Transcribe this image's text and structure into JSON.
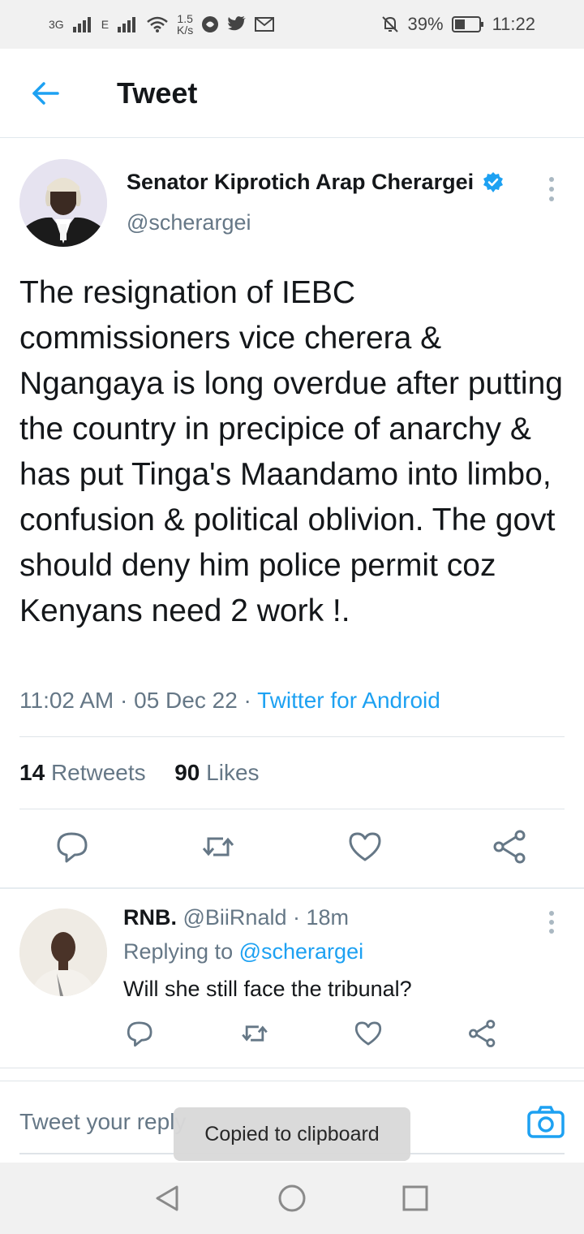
{
  "status_bar": {
    "network": "3G",
    "network2": "E",
    "speed_value": "1.5",
    "speed_unit": "K/s",
    "battery": "39%",
    "time": "11:22"
  },
  "app_bar": {
    "title": "Tweet"
  },
  "tweet": {
    "author_name": "Senator Kiprotich Arap Cherargei",
    "author_handle": "@scherargei",
    "text": "The resignation of IEBC commissioners vice cherera & Ngangaya is long overdue after putting the country in precipice of anarchy & has put Tinga's Maandamo into limbo, confusion & political oblivion. The govt should deny him police permit coz Kenyans need 2 work !.",
    "time": "11:02 AM",
    "date": "05 Dec 22",
    "source": "Twitter for Android",
    "retweets_count": "14",
    "retweets_label": "Retweets",
    "likes_count": "90",
    "likes_label": "Likes"
  },
  "reply": {
    "name": "RNB.",
    "handle": "@BiiRnald",
    "age": "18m",
    "replying_prefix": "Replying to",
    "replying_to": "@scherargei",
    "text": "Will she still face the tribunal?"
  },
  "composer": {
    "placeholder": "Tweet your reply"
  },
  "toast": {
    "message": "Copied to clipboard"
  },
  "colors": {
    "accent": "#1da1f2",
    "muted": "#657786",
    "text": "#14171a",
    "verified": "#1da1f2"
  }
}
